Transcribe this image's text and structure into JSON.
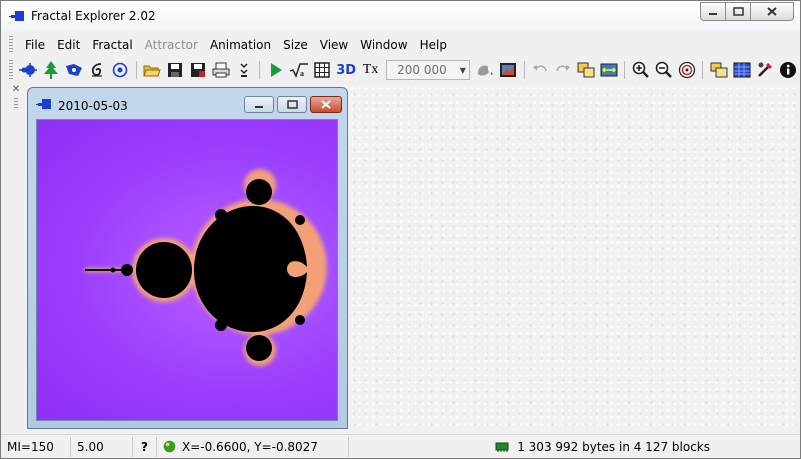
{
  "window": {
    "title": "Fractal Explorer 2.02"
  },
  "menu": [
    "File",
    "Edit",
    "Fractal",
    "Attractor",
    "Animation",
    "Size",
    "View",
    "Window",
    "Help"
  ],
  "toolbar": {
    "three_d_label": "3D",
    "tx_label": "Tx",
    "iterations_value": "200 000"
  },
  "child": {
    "title": "2010-05-03"
  },
  "status": {
    "mi": "MI=150",
    "zoom": "5.00",
    "help": "?",
    "coords": "X=-0.6600, Y=-0.8027",
    "memory": "1 303 992 bytes in 4 127 blocks"
  },
  "colors": {
    "fractal_background": "#9a3cfc",
    "fractal_set": "#000000",
    "fractal_edge": "#ffb060"
  }
}
